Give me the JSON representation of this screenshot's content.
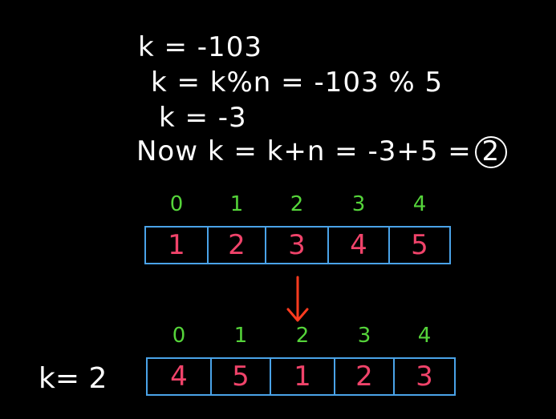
{
  "notes": {
    "line1": "k = -103",
    "line2": "k = k%n = -103 % 5",
    "line3": "k = -3",
    "line4_prefix": "Now k = k+n = -3+5 =",
    "line4_result": "2"
  },
  "colors": {
    "background": "#000000",
    "text": "#ffffff",
    "index": "#55d43a",
    "value": "#f0436a",
    "cell_border": "#4aa3e8",
    "arrow": "#ff3b1f"
  },
  "array_before": {
    "indices": [
      "0",
      "1",
      "2",
      "3",
      "4"
    ],
    "values": [
      "1",
      "2",
      "3",
      "4",
      "5"
    ]
  },
  "array_after": {
    "indices": [
      "0",
      "1",
      "2",
      "3",
      "4"
    ],
    "values": [
      "4",
      "5",
      "1",
      "2",
      "3"
    ]
  },
  "k_label": "k= 2",
  "arrow_icon": "down-arrow-icon"
}
